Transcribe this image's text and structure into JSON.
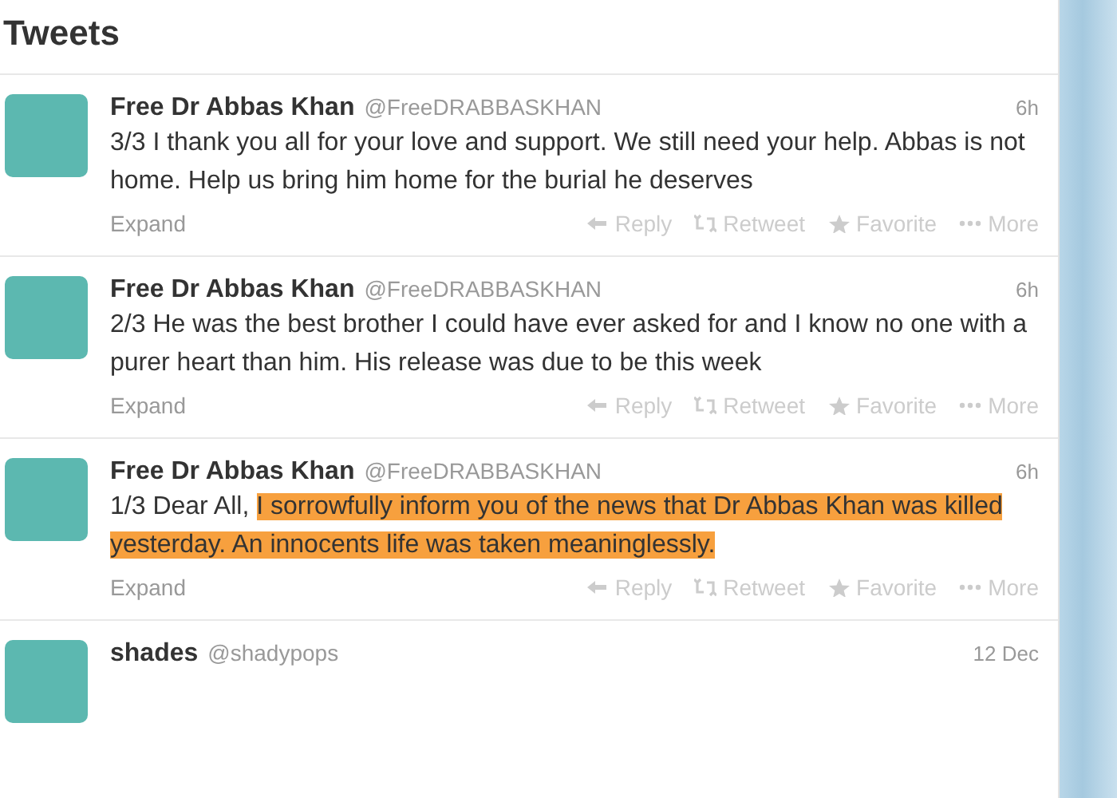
{
  "header": {
    "title": "Tweets"
  },
  "tweets": [
    {
      "name": "Free Dr Abbas Khan",
      "handle": "@FreeDRABBASKHAN",
      "time": "6h",
      "text": "3/3 I thank you all for your love and support. We still need your help. Abbas is not home. Help us bring him home for the burial he deserves",
      "expand": "Expand",
      "actions": [
        "Reply",
        "Retweet",
        "Favorite",
        "More"
      ]
    },
    {
      "name": "Free Dr Abbas Khan",
      "handle": "@FreeDRABBASKHAN",
      "time": "6h",
      "text": "2/3 He was the best brother I could have ever asked for and I know no one with a purer heart than him. His release was due to be this week",
      "expand": "Expand",
      "actions": [
        "Reply",
        "Retweet",
        "Favorite",
        "More"
      ]
    },
    {
      "name": "Free Dr Abbas Khan",
      "handle": "@FreeDRABBASKHAN",
      "time": "6h",
      "text": "1/3 Dear All, ",
      "highlight": "I sorrowfully inform you of the news that Dr Abbas Khan was killed yesterday. An innocents life was taken meaninglessly.",
      "expand": "Expand",
      "actions": [
        "Reply",
        "Retweet",
        "Favorite",
        "More"
      ]
    },
    {
      "name": "shades",
      "handle": "@shadypops",
      "time": "12 Dec"
    }
  ]
}
